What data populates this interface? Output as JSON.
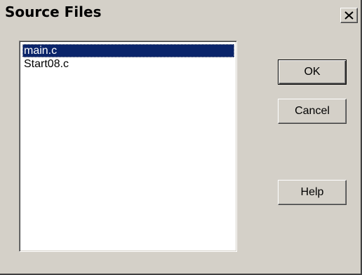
{
  "dialog": {
    "title": "Source Files",
    "close_glyph": "×"
  },
  "file_list": {
    "items": [
      {
        "label": "main.c",
        "selected": true
      },
      {
        "label": "Start08.c",
        "selected": false
      }
    ]
  },
  "buttons": {
    "ok_label": "OK",
    "cancel_label": "Cancel",
    "help_label": "Help"
  },
  "colors": {
    "face": "#d4d0c8",
    "selection": "#0a246a",
    "list_bg": "#ffffff"
  },
  "icons": {
    "close": "close-icon"
  }
}
